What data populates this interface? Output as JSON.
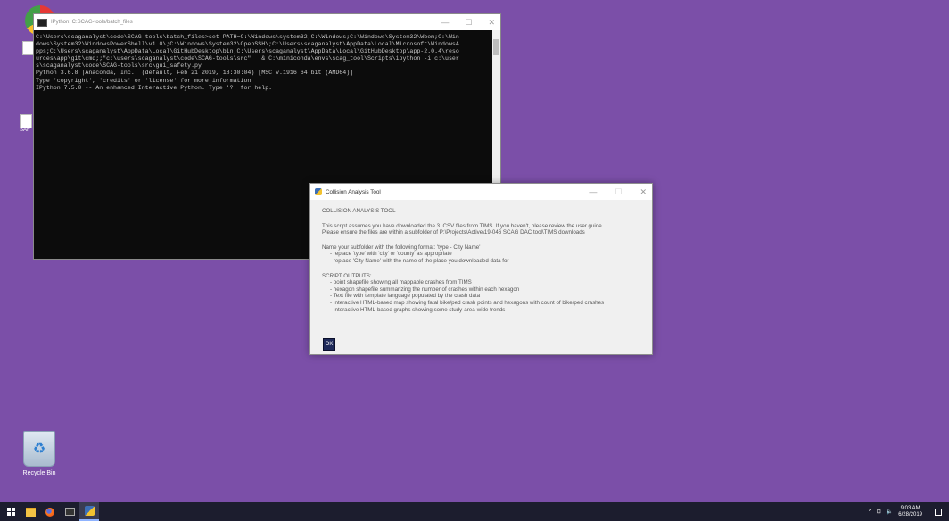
{
  "desktop": {
    "recycle_bin_label": "Recycle Bin",
    "shortcut_label": "SAF"
  },
  "console": {
    "title": "IPython: C:SCAG-tools/batch_files",
    "lines": [
      "C:\\Users\\scaganalyst\\code\\SCAG-tools\\batch_files>set PATH=C:\\Windows\\system32;C:\\Windows;C:\\Windows\\System32\\Wbem;C:\\Win",
      "dows\\System32\\WindowsPowerShell\\v1.0\\;C:\\Windows\\System32\\OpenSSH\\;C:\\Users\\scaganalyst\\AppData\\Local\\Microsoft\\WindowsA",
      "pps;C:\\Users\\scaganalyst\\AppData\\Local\\GitHubDesktop\\bin;C:\\Users\\scaganalyst\\AppData\\Local\\GitHubDesktop\\app-2.0.4\\reso",
      "urces\\app\\git\\cmd;;\"c:\\users\\scaganalyst\\code\\SCAG-tools\\src\"   & C:\\miniconda\\envs\\scag_tool\\Scripts\\ipython -i c:\\user",
      "s\\scaganalyst\\code\\SCAG-tools\\src\\gui_safety.py",
      "Python 3.6.8 |Anaconda, Inc.| (default, Feb 21 2019, 18:30:04) [MSC v.1916 64 bit (AMD64)]",
      "Type 'copyright', 'credits' or 'license' for more information",
      "IPython 7.5.0 -- An enhanced Interactive Python. Type '?' for help."
    ]
  },
  "dialog": {
    "title": "Collision Analysis Tool",
    "heading": "COLLISION ANALYSIS TOOL",
    "intro_1": "This script assumes you have downloaded the 3 .CSV files from TIMS. If you haven't, please review the user guide.",
    "intro_2": "Please ensure the files are within a subfolder of P:\\Projects\\Active\\19-046 SCAG DAC tool\\TIMS downloads",
    "naming_1": "Name your subfolder with the following format: 'type - City Name'",
    "naming_2": "- replace 'type' with 'city' or 'county' as appropriate",
    "naming_3": "- replace 'City Name' with the name of the place you downloaded data for",
    "outputs_heading": "SCRIPT OUTPUTS:",
    "outputs": [
      "- point shapefile showing all mappable crashes from TIMS",
      "- hexagon shapefile summarizing the number of crashes within each hexagon",
      "- Text file with template language populated by the crash data",
      "- Interactive HTML-based map showing fatal bike/ped crash points and hexagons with count of bike/ped crashes",
      "- Interactive HTML-based graphs showing some study-area-wide trends"
    ],
    "ok_label": "OK"
  },
  "taskbar": {
    "time": "9:03 AM",
    "date": "6/28/2019"
  }
}
